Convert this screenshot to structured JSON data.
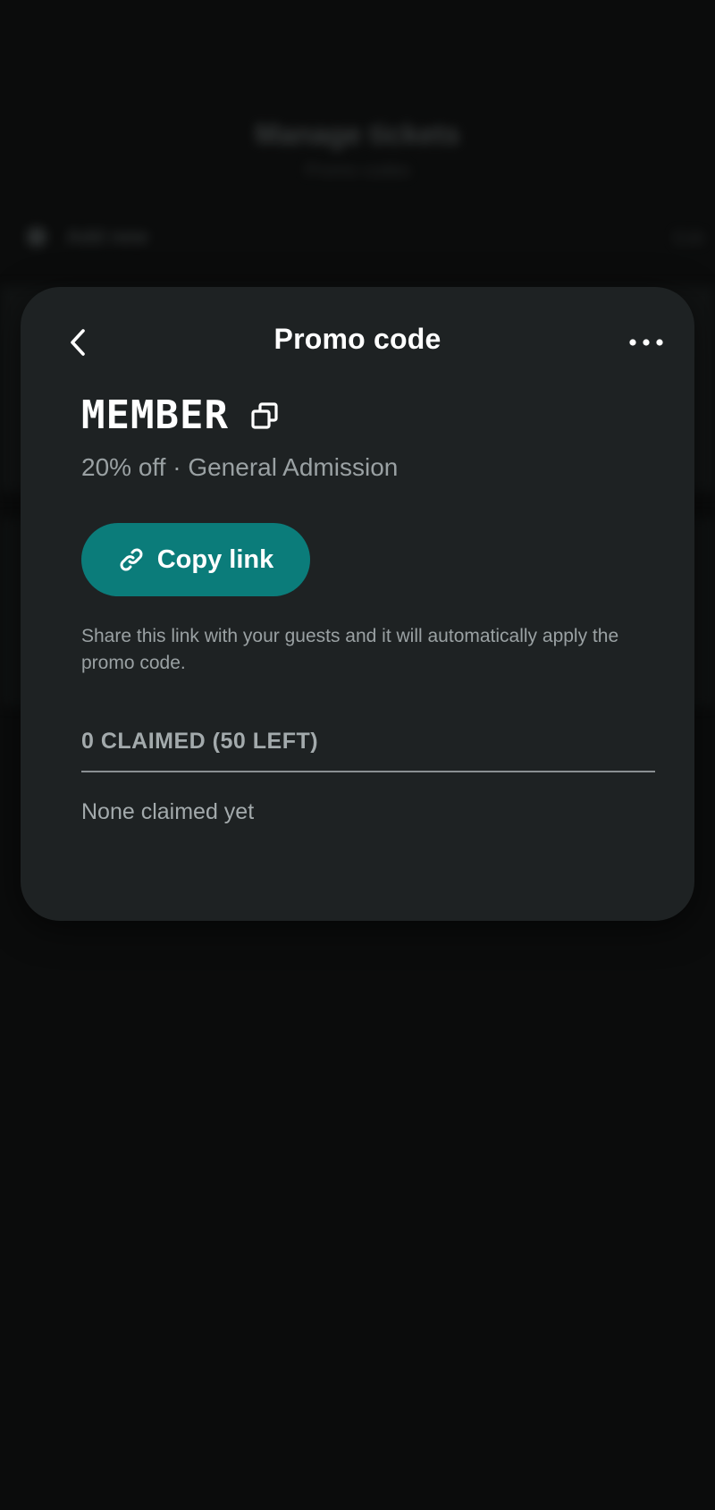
{
  "background": {
    "title": "Manage tickets",
    "subtitle": "Promo codes",
    "add_label": "Add new",
    "edit_label": "Edit"
  },
  "sheet": {
    "title": "Promo code",
    "back_icon": "chevron-left-icon",
    "more_icon": "more-horizontal-icon",
    "code": "MEMBER",
    "copy_code_icon": "copy-icon",
    "discount_line": "20% off · General Admission",
    "copy_link": {
      "label": "Copy link",
      "icon": "link-icon"
    },
    "share_hint": "Share this link with your guests and it will automatically apply the promo code.",
    "claimed_header": "0 CLAIMED (50 LEFT)",
    "empty_state": "None claimed yet"
  },
  "colors": {
    "accent": "#0b7c7a",
    "sheet_bg": "#1e2223",
    "page_bg": "#0b0c0c",
    "muted_text": "#9aa1a3"
  }
}
